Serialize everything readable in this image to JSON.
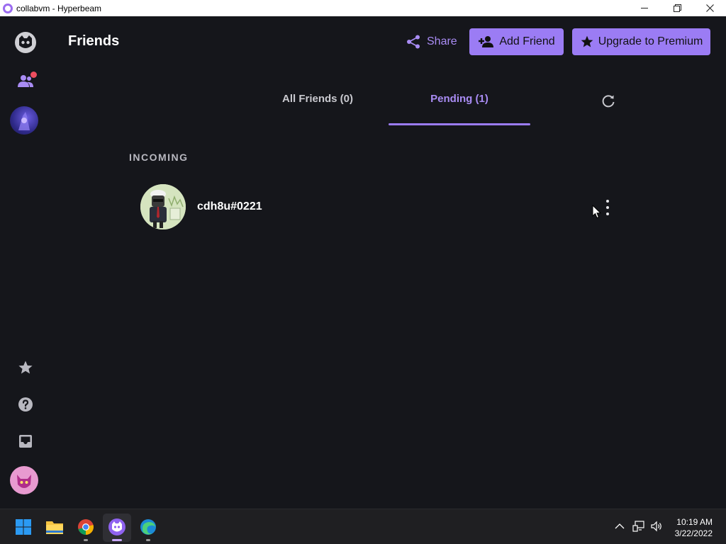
{
  "window": {
    "title": "collabvm - Hyperbeam",
    "icons": {
      "minimize": "minimize-icon",
      "restore": "restore-icon",
      "close": "close-icon"
    }
  },
  "sidebar": {
    "items": [
      {
        "icon": "hyperbeam-logo-icon"
      },
      {
        "icon": "friends-icon",
        "has_notification": true
      },
      {
        "icon": "room-avatar"
      },
      {
        "icon": "star-icon"
      },
      {
        "icon": "help-icon"
      },
      {
        "icon": "inbox-icon"
      },
      {
        "icon": "user-avatar"
      }
    ]
  },
  "header": {
    "title": "Friends",
    "share_label": "Share",
    "add_friend_label": "Add Friend",
    "premium_label": "Upgrade to Premium"
  },
  "tabs": [
    {
      "label": "All Friends (0)",
      "active": false
    },
    {
      "label": "Pending (1)",
      "active": true
    }
  ],
  "incoming": {
    "section_label": "INCOMING",
    "requests": [
      {
        "name": "cdh8u#0221"
      }
    ]
  },
  "colors": {
    "accent": "#9b7cf4",
    "accent_text": "#a98cf4",
    "background": "#15161b",
    "notification": "#ee4d5f"
  },
  "taskbar": {
    "apps": [
      "windows-start-icon",
      "file-explorer-icon",
      "chrome-icon",
      "hyperbeam-icon",
      "edge-icon"
    ],
    "time": "10:19 AM",
    "date": "3/22/2022"
  }
}
